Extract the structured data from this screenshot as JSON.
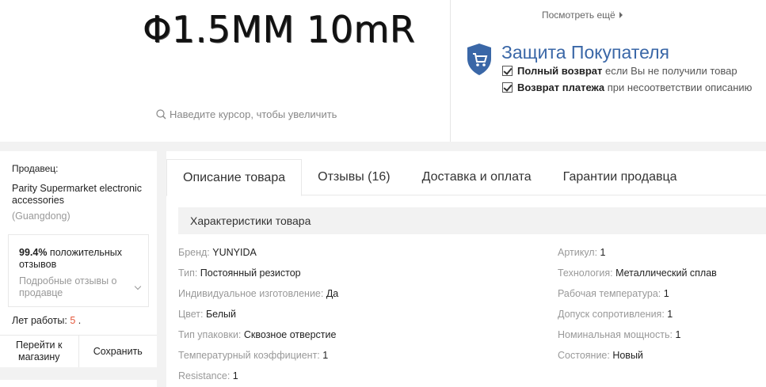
{
  "product_image": {
    "text": "Φ1.5MM 10mR"
  },
  "zoom_hint": "Наведите курсор, чтобы увеличить",
  "see_more": "Посмотреть ещё",
  "protection": {
    "title": "Защита Покупателя",
    "items": [
      {
        "bold": "Полный возврат",
        "rest": " если Вы не получили товар"
      },
      {
        "bold": "Возврат платежа",
        "rest": " при несоответствии описанию"
      }
    ],
    "accent": "#3a67a7"
  },
  "seller": {
    "label": "Продавец:",
    "name": "Parity Supermarket electronic accessories",
    "region": "(Guangdong)",
    "positive_pct": "99.4%",
    "positive_text": " положительных отзывов",
    "detail_link": "Подробные отзывы о продавце",
    "years_label": "Лет работы: ",
    "years_value": "5",
    "years_suffix": " .",
    "go_store": "Перейти к магазину",
    "save": "Сохранить"
  },
  "tabs": [
    {
      "label": "Описание товара",
      "active": true
    },
    {
      "label": "Отзывы (16)",
      "active": false
    },
    {
      "label": "Доставка и оплата",
      "active": false
    },
    {
      "label": "Гарантии продавца",
      "active": false
    }
  ],
  "specs": {
    "header": "Характеристики товара",
    "left": [
      {
        "k": "Бренд: ",
        "v": "YUNYIDA"
      },
      {
        "k": "Тип: ",
        "v": "Постоянный резистор"
      },
      {
        "k": "Индивидуальное изготовление: ",
        "v": "Да"
      },
      {
        "k": "Цвет: ",
        "v": "Белый"
      },
      {
        "k": "Тип упаковки: ",
        "v": "Сквозное отверстие"
      },
      {
        "k": "Температурный коэффициент: ",
        "v": "1"
      },
      {
        "k": "Resistance: ",
        "v": "1"
      }
    ],
    "right": [
      {
        "k": "Артикул: ",
        "v": "1"
      },
      {
        "k": "Технология: ",
        "v": "Металлический сплав"
      },
      {
        "k": "Рабочая температура: ",
        "v": "1"
      },
      {
        "k": "Допуск сопротивления: ",
        "v": "1"
      },
      {
        "k": "Номинальная мощность: ",
        "v": "1"
      },
      {
        "k": "Состояние: ",
        "v": "Новый"
      }
    ]
  }
}
